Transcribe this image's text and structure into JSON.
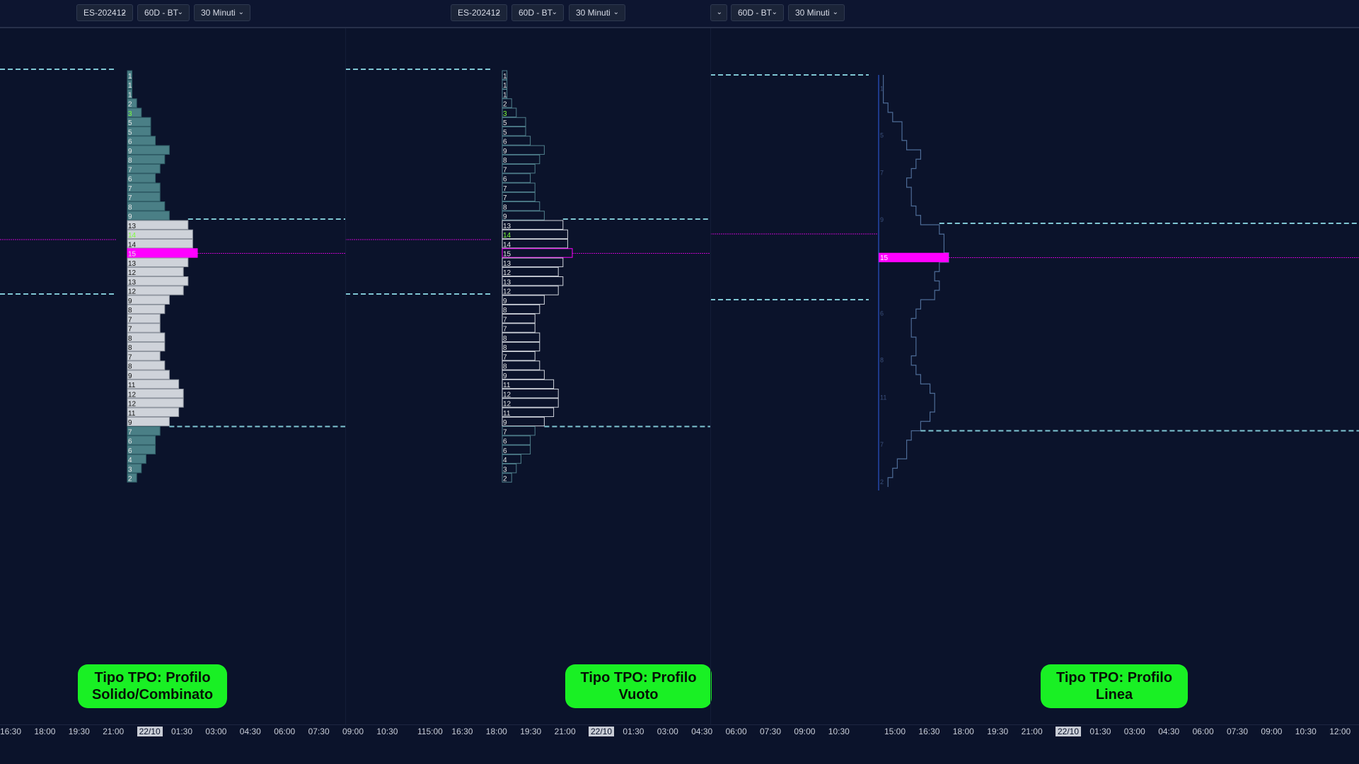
{
  "toolbar": [
    {
      "symbol": "ES-202412",
      "period": "60D - BT",
      "interval": "30 Minuti"
    },
    {
      "symbol": "ES-202412",
      "period": "60D - BT",
      "interval": "30 Minuti"
    },
    {
      "symbol": "",
      "period": "60D - BT",
      "interval": "30 Minuti"
    }
  ],
  "panels": [
    {
      "caption_line1": "Tipo TPO: Profilo",
      "caption_line2": "Solido/Combinato"
    },
    {
      "caption_line1": "Tipo TPO: Profilo",
      "caption_line2": "Vuoto"
    },
    {
      "caption_line1": "Tipo TPO: Profilo",
      "caption_line2": "Linea"
    }
  ],
  "profile_counts": [
    1,
    1,
    1,
    2,
    3,
    5,
    5,
    6,
    9,
    8,
    7,
    6,
    7,
    7,
    8,
    9,
    13,
    14,
    14,
    15,
    13,
    12,
    13,
    12,
    9,
    8,
    7,
    7,
    8,
    8,
    7,
    8,
    9,
    11,
    12,
    12,
    11,
    9,
    7,
    6,
    6,
    4,
    3,
    2
  ],
  "value_area_bounds": [
    "9",
    "9"
  ],
  "poc_count": "15",
  "highlight_counts": [
    "3",
    "14"
  ],
  "line_profile_labels": [
    "1",
    "5",
    "7",
    "9",
    "15",
    "6",
    "8",
    "11",
    "7",
    "2"
  ],
  "colors": {
    "background": "#0b132b",
    "poc": "#ff00ff",
    "value_area_fill": "#cfd3da",
    "outer_fill": "#4a7f86",
    "value_area_line": "#7fc6d3",
    "highlight_text": "#7dff3a",
    "caption_bg": "#19f024"
  },
  "axis": {
    "ticks_left": [
      "16:30",
      "18:00",
      "19:30",
      "21:00",
      "22/10",
      "01:30",
      "03:00",
      "04:30",
      "06:00",
      "07:30",
      "09:00",
      "10:30"
    ],
    "ticks_mid": [
      "115:00",
      "16:30",
      "18:00",
      "19:30",
      "21:00",
      "22/10",
      "01:30",
      "03:00",
      "04:30",
      "06:00",
      "07:30",
      "09:00",
      "10:30"
    ],
    "ticks_right": [
      "15:00",
      "16:30",
      "18:00",
      "19:30",
      "21:00",
      "22/10",
      "01:30",
      "03:00",
      "04:30",
      "06:00",
      "07:30",
      "09:00",
      "10:30",
      "12:00"
    ]
  }
}
